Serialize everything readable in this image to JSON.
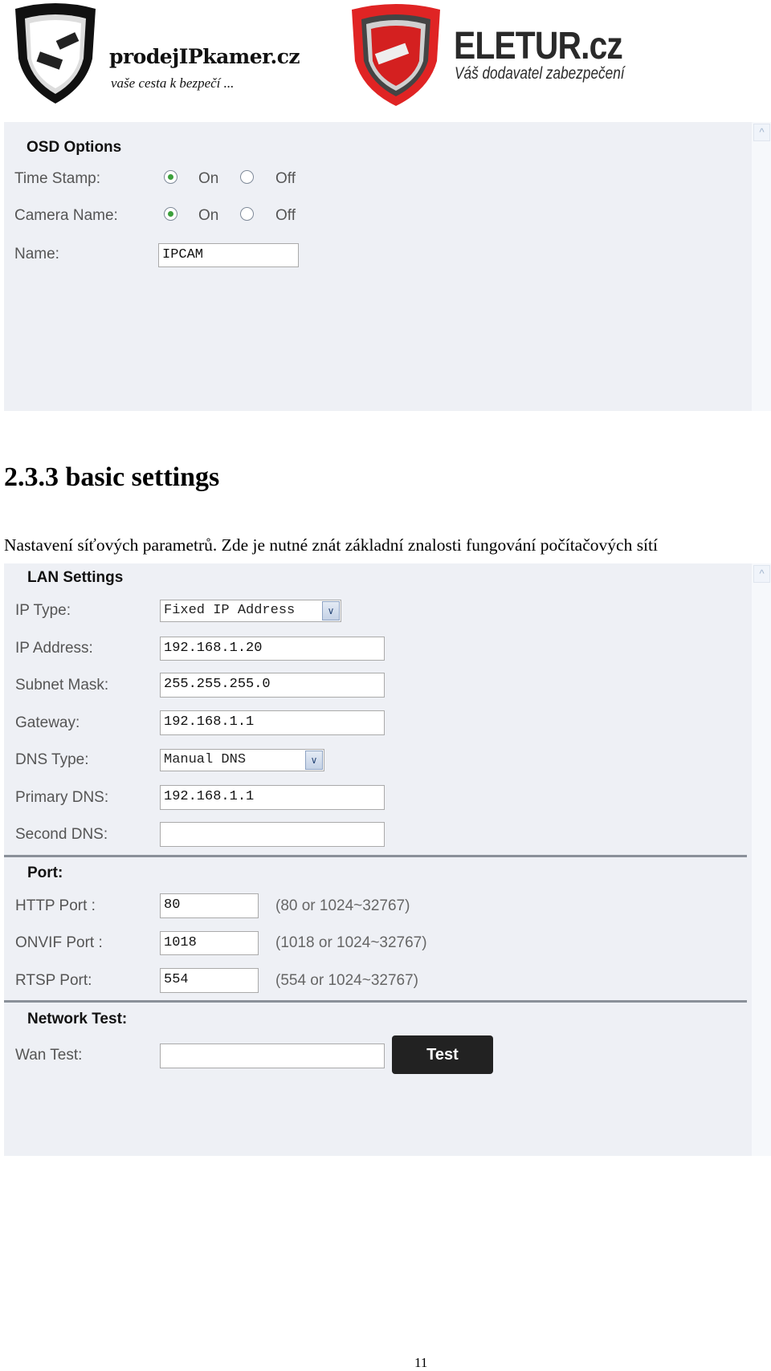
{
  "logos": {
    "left": {
      "name": "prodejIPkamer.cz",
      "tagline": "vaše cesta k bezpečí ..."
    },
    "right": {
      "name": "ELETUR.cz",
      "tagline": "Váš dodavatel zabezpečení"
    }
  },
  "osd": {
    "title": "OSD Options",
    "time_stamp": {
      "label": "Time Stamp:",
      "on": "On",
      "off": "Off",
      "selected": "On"
    },
    "camera_name": {
      "label": "Camera Name:",
      "on": "On",
      "off": "Off",
      "selected": "On"
    },
    "name": {
      "label": "Name:",
      "value": "IPCAM"
    }
  },
  "heading": "2.3.3 basic settings",
  "paragraph": "Nastavení síťových parametrů. Zde je nutné znát základní znalosti fungování počítačových sítí",
  "lan": {
    "title": "LAN Settings",
    "ip_type": {
      "label": "IP Type:",
      "value": "Fixed IP Address"
    },
    "ip_address": {
      "label": "IP Address:",
      "value": "192.168.1.20"
    },
    "subnet_mask": {
      "label": "Subnet Mask:",
      "value": "255.255.255.0"
    },
    "gateway": {
      "label": "Gateway:",
      "value": "192.168.1.1"
    },
    "dns_type": {
      "label": "DNS Type:",
      "value": "Manual DNS"
    },
    "primary_dns": {
      "label": "Primary DNS:",
      "value": "192.168.1.1"
    },
    "second_dns": {
      "label": "Second DNS:",
      "value": ""
    }
  },
  "port": {
    "title": "Port:",
    "http": {
      "label": "HTTP Port :",
      "value": "80",
      "hint": "(80 or 1024~32767)"
    },
    "onvif": {
      "label": "ONVIF Port :",
      "value": "1018",
      "hint": "(1018 or 1024~32767)"
    },
    "rtsp": {
      "label": "RTSP Port:",
      "value": "554",
      "hint": "(554 or 1024~32767)"
    }
  },
  "network_test": {
    "title": "Network Test:",
    "wan": {
      "label": "Wan Test:",
      "value": ""
    },
    "button": "Test"
  },
  "page_number": "11"
}
